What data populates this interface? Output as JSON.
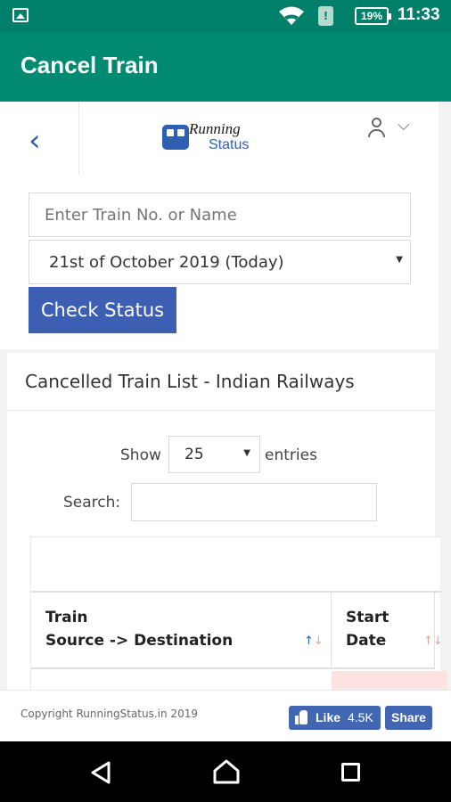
{
  "status_bar": {
    "battery": "19%",
    "time": "11:33",
    "sim_label": "!",
    "icons": [
      "gallery-icon",
      "wifi-icon",
      "sim-icon",
      "battery-icon"
    ]
  },
  "app_bar": {
    "title": "Cancel Train"
  },
  "site_header": {
    "logo_line1": "Running",
    "logo_line2": "Status",
    "icons": [
      "back-arrow-icon",
      "train-icon",
      "user-icon",
      "chevron-down-icon"
    ]
  },
  "form": {
    "train_placeholder": "Enter Train No. or Name",
    "date_selected": "21st of October 2019 (Today)",
    "check_button": "Check Status"
  },
  "list": {
    "title": "Cancelled Train List - Indian Railways",
    "show_label": "Show",
    "entries_value": "25",
    "entries_label": "entries",
    "search_label": "Search:",
    "columns": [
      {
        "line1": "Train",
        "line2": "Source -> Destination"
      },
      {
        "line1": "Start",
        "line2": "Date"
      }
    ]
  },
  "footer": {
    "copyright": "Copyright RunningStatus.in 2019",
    "like_label": "Like",
    "like_count": "4.5K",
    "share_label": "Share"
  },
  "colors": {
    "app_bar": "#008a72",
    "status_bar": "#00806a",
    "button_blue": "#3d5fb3",
    "facebook_blue": "#4267b2"
  }
}
